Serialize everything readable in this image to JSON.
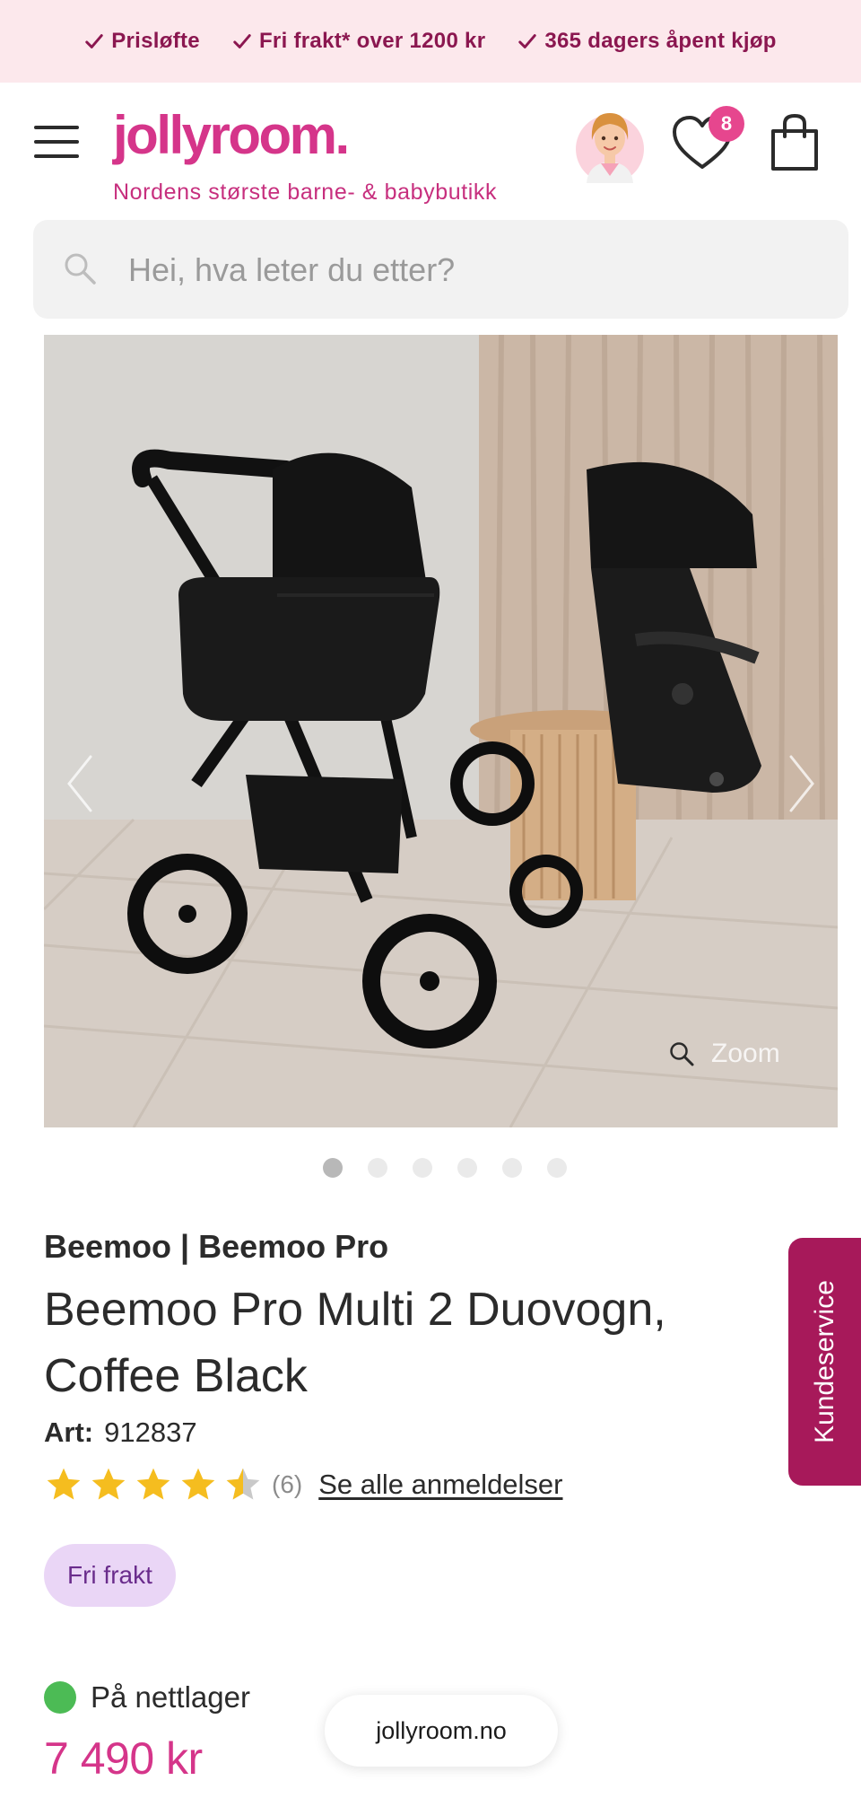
{
  "promo": {
    "items": [
      "Prisløfte",
      "Fri frakt* over 1200 kr",
      "365 dagers åpent kjøp"
    ]
  },
  "header": {
    "logo": "jollyroom.",
    "tagline": "Nordens største barne- & babybutikk",
    "wishlist_count": "8",
    "icons": [
      "menu-icon",
      "avatar-icon",
      "heart-icon",
      "shopping-bag-icon"
    ]
  },
  "search": {
    "placeholder": "Hei, hva leter du etter?"
  },
  "gallery": {
    "zoom_label": "Zoom",
    "dot_count": 6,
    "active_index": 0
  },
  "product": {
    "brand": "Beemoo | Beemoo Pro",
    "title": "Beemoo Pro Multi 2 Duovogn, Coffee Black",
    "art_label": "Art:",
    "art_number": "912837",
    "rating": 4.5,
    "review_count": "(6)",
    "reviews_link": "Se alle anmeldelser",
    "badge": "Fri frakt",
    "stock_status": "På nettlager",
    "price": "7 490 kr"
  },
  "browser": {
    "url": "jollyroom.no"
  },
  "side_tab": {
    "label": "Kundeservice"
  },
  "colors": {
    "brand_pink": "#d5358a",
    "promo_bg": "#fce8ec",
    "badge_bg": "#ead6f6",
    "in_stock": "#4cbb55",
    "side_tab": "#a7195a",
    "star": "#f5bd1f"
  }
}
